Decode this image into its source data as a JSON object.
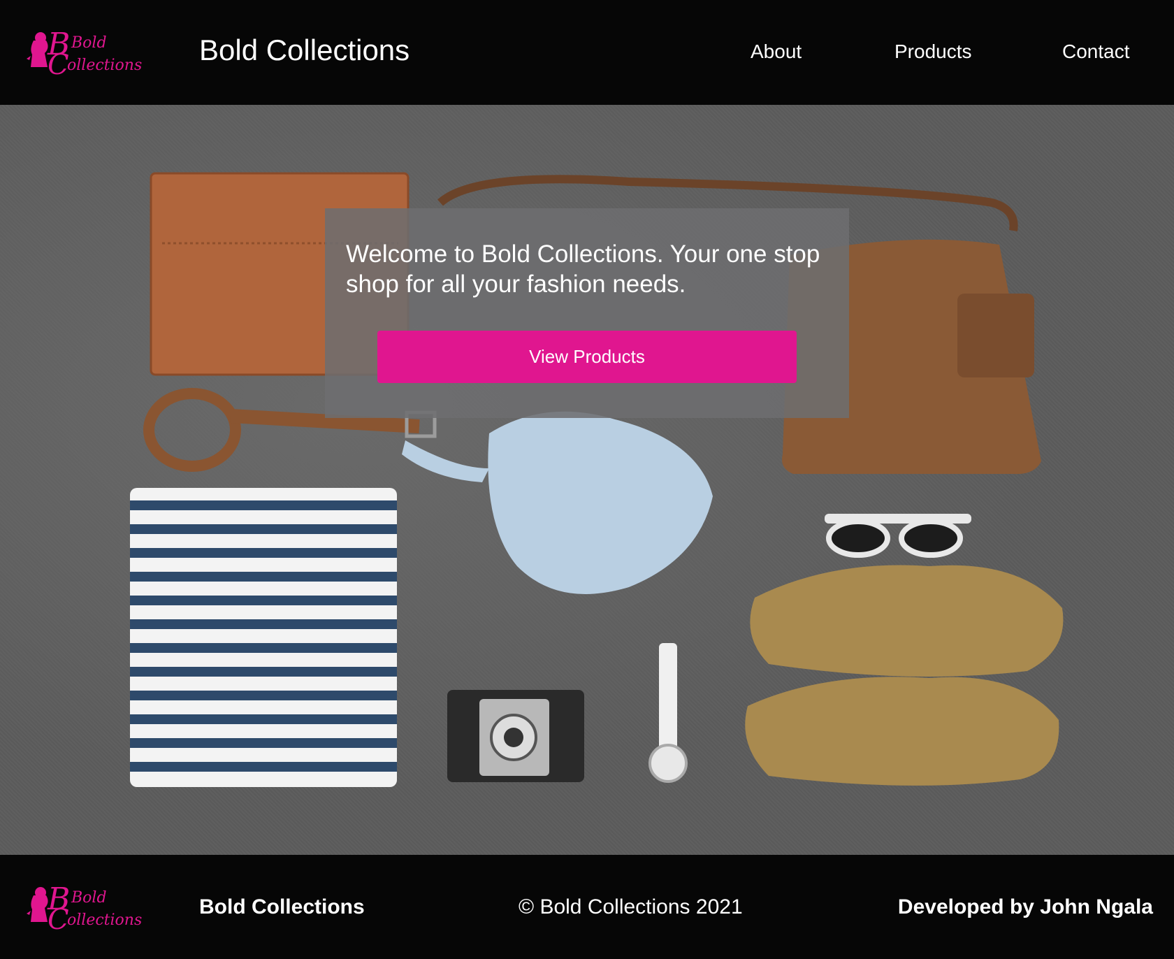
{
  "colors": {
    "brand_pink": "#e0168f",
    "background": "#060606",
    "overlay": "#6e6e70"
  },
  "header": {
    "logo_icon": "bold-collections-logo",
    "logo_text_line1": "Bold",
    "logo_text_line2": "Collections",
    "title": "Bold Collections",
    "nav": [
      {
        "label": "About"
      },
      {
        "label": "Products"
      },
      {
        "label": "Contact"
      }
    ]
  },
  "hero": {
    "welcome_text": "Welcome to Bold Collections. Your one stop shop for all your fashion needs.",
    "cta_label": "View Products"
  },
  "footer": {
    "brand": "Bold Collections",
    "copyright": "© Bold Collections 2021",
    "developer": "Developed by John Ngala"
  }
}
